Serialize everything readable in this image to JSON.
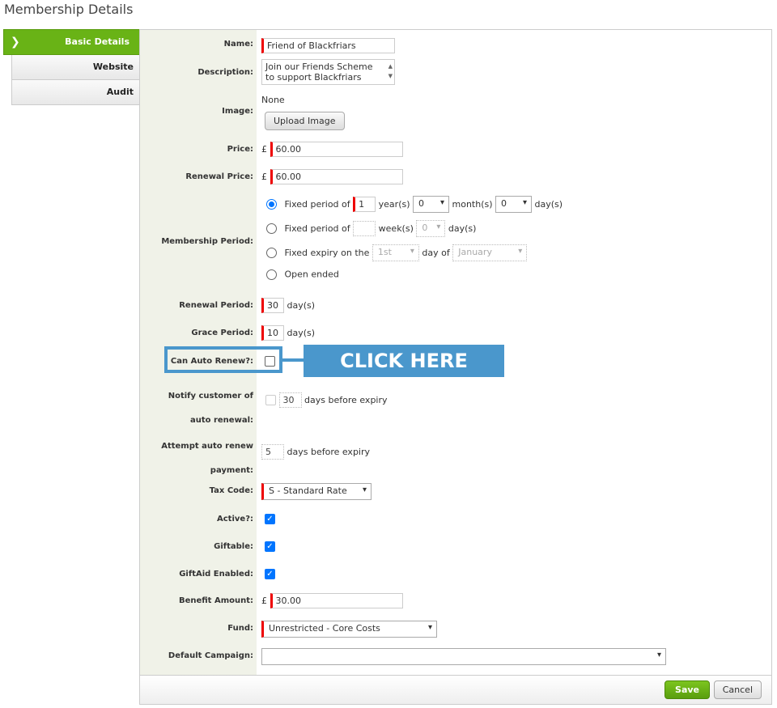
{
  "page_title": "Membership Details",
  "tabs": [
    {
      "label": "Basic Details",
      "active": true
    },
    {
      "label": "Website",
      "active": false
    },
    {
      "label": "Audit",
      "active": false
    }
  ],
  "form": {
    "name": {
      "label": "Name:",
      "value": "Friend of Blackfriars"
    },
    "description": {
      "label": "Description:",
      "line1": "Join our Friends Scheme",
      "line2": "to support Blackfriars"
    },
    "image": {
      "label": "Image:",
      "value": "None",
      "upload_button": "Upload Image"
    },
    "price": {
      "label": "Price:",
      "currency": "£",
      "value": "60.00"
    },
    "renewal_price": {
      "label": "Renewal Price:",
      "currency": "£",
      "value": "60.00"
    },
    "membership_period": {
      "label": "Membership Period:",
      "fixed_period": {
        "text": "Fixed period of",
        "years": "1",
        "years_unit": "year(s)",
        "months": "0",
        "months_unit": "month(s)",
        "days": "0",
        "days_unit": "day(s)",
        "selected": true
      },
      "fixed_weeks": {
        "text": "Fixed period of",
        "weeks": "",
        "weeks_unit": "week(s)",
        "days": "0",
        "days_unit": "day(s)"
      },
      "fixed_expiry": {
        "text": "Fixed expiry on the",
        "day": "1st",
        "day_of": "day of",
        "month": "January"
      },
      "open_ended": {
        "text": "Open ended"
      }
    },
    "renewal_period": {
      "label": "Renewal Period:",
      "value": "30",
      "unit": "day(s)"
    },
    "grace_period": {
      "label": "Grace Period:",
      "value": "10",
      "unit": "day(s)"
    },
    "can_auto_renew": {
      "label": "Can Auto Renew?:",
      "checked": false
    },
    "notify": {
      "label_line1": "Notify customer of",
      "label_line2": "auto renewal:",
      "value": "30",
      "suffix": "days before expiry"
    },
    "attempt": {
      "label_line1": "Attempt auto renew",
      "label_line2": "payment:",
      "value": "5",
      "suffix": "days before expiry"
    },
    "tax_code": {
      "label": "Tax Code:",
      "value": "S - Standard Rate"
    },
    "active": {
      "label": "Active?:",
      "checked": true
    },
    "giftable": {
      "label": "Giftable:",
      "checked": true
    },
    "giftaid": {
      "label": "GiftAid Enabled:",
      "checked": true
    },
    "benefit_amount": {
      "label": "Benefit Amount:",
      "currency": "£",
      "value": "30.00"
    },
    "fund": {
      "label": "Fund:",
      "value": "Unrestricted - Core Costs"
    },
    "default_campaign": {
      "label": "Default Campaign:",
      "value": ""
    }
  },
  "footer": {
    "save": "Save",
    "cancel": "Cancel"
  },
  "annotation": {
    "text": "CLICK HERE",
    "color": "#4a97cc"
  },
  "icons": {
    "chevron_right": "❯",
    "select_arrow": "⌄",
    "check": "✓",
    "scroll_up": "▲",
    "scroll_down": "▼"
  }
}
